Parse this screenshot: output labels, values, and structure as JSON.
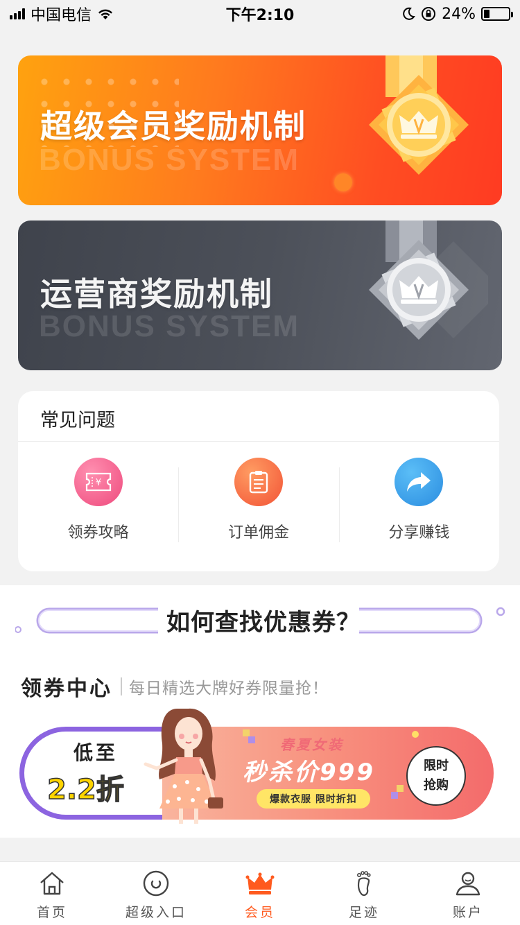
{
  "status_bar": {
    "carrier": "中国电信",
    "time": "下午2:10",
    "battery_percent": "24%",
    "battery_level": 0.24
  },
  "banners": [
    {
      "title": "超级会员奖励机制",
      "subtitle": "BONUS SYSTEM",
      "theme": "gold"
    },
    {
      "title": "运营商奖励机制",
      "subtitle": "BONUS SYSTEM",
      "theme": "silver"
    }
  ],
  "faq": {
    "title": "常见问题",
    "items": [
      {
        "label": "领券攻略",
        "icon": "coupon-icon",
        "color": "#ee4a7d"
      },
      {
        "label": "订单佣金",
        "icon": "order-icon",
        "color": "#f25336"
      },
      {
        "label": "分享赚钱",
        "icon": "share-icon",
        "color": "#2b8de0"
      }
    ]
  },
  "how_to": {
    "title": "如何查找优惠券？"
  },
  "coupon_center": {
    "title": "领券中心",
    "subtitle": "每日精选大牌好券限量抢！"
  },
  "promo": {
    "low_to": "低至",
    "discount": "2.2折",
    "season": "春夏女装",
    "price": "秒杀价999",
    "tag": "爆款衣服 限时折扣",
    "badge_line1": "限时",
    "badge_line2": "抢购"
  },
  "tab_bar": {
    "items": [
      {
        "label": "首页",
        "icon": "home-icon"
      },
      {
        "label": "超级入口",
        "icon": "portal-icon"
      },
      {
        "label": "会员",
        "icon": "crown-icon",
        "active": true
      },
      {
        "label": "足迹",
        "icon": "footprint-icon"
      },
      {
        "label": "账户",
        "icon": "user-icon"
      }
    ]
  },
  "colors": {
    "accent": "#ff5a1e",
    "gold_banner": "#ff7a1e",
    "dark_banner": "#4c5059",
    "promo_border": "#8c64e0"
  }
}
